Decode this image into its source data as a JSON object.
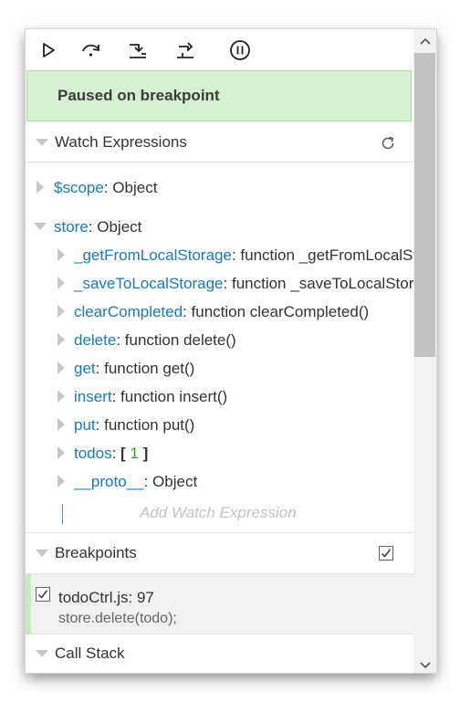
{
  "toolbar": {
    "buttons": [
      {
        "name": "resume-icon"
      },
      {
        "name": "step-over-icon"
      },
      {
        "name": "step-into-icon"
      },
      {
        "name": "step-out-icon"
      },
      {
        "name": "pause-exceptions-icon"
      }
    ]
  },
  "status": {
    "paused": "Paused on breakpoint"
  },
  "watch": {
    "title": "Watch Expressions",
    "scope": {
      "key": "$scope",
      "sep": ": ",
      "value": "Object"
    },
    "store": {
      "key": "store",
      "sep": ": ",
      "value": "Object"
    },
    "children": [
      {
        "key": "_getFromLocalStorage",
        "value": "function _getFromLocalStorage()"
      },
      {
        "key": "_saveToLocalStorage",
        "value": "function _saveToLocalStorage()"
      },
      {
        "key": "clearCompleted",
        "value": "function clearCompleted()"
      },
      {
        "key": "delete",
        "value": "function delete()"
      },
      {
        "key": "get",
        "value": "function get()"
      },
      {
        "key": "insert",
        "value": "function insert()"
      },
      {
        "key": "put",
        "value": "function put()"
      }
    ],
    "todos": {
      "key": "todos",
      "open": "[ ",
      "count": "1",
      "close": " ]"
    },
    "proto": {
      "key": "__proto__",
      "value": "Object"
    },
    "add_placeholder": "Add Watch Expression"
  },
  "breakpoints": {
    "title": "Breakpoints",
    "items": [
      {
        "location": "todoCtrl.js: 97",
        "code": "store.delete(todo);",
        "checked": true
      }
    ]
  },
  "callstack": {
    "title": "Call Stack"
  },
  "colors": {
    "paused_bg": "#d6f0d2",
    "key": "#1a7ab8",
    "number": "#2e9b2e"
  }
}
